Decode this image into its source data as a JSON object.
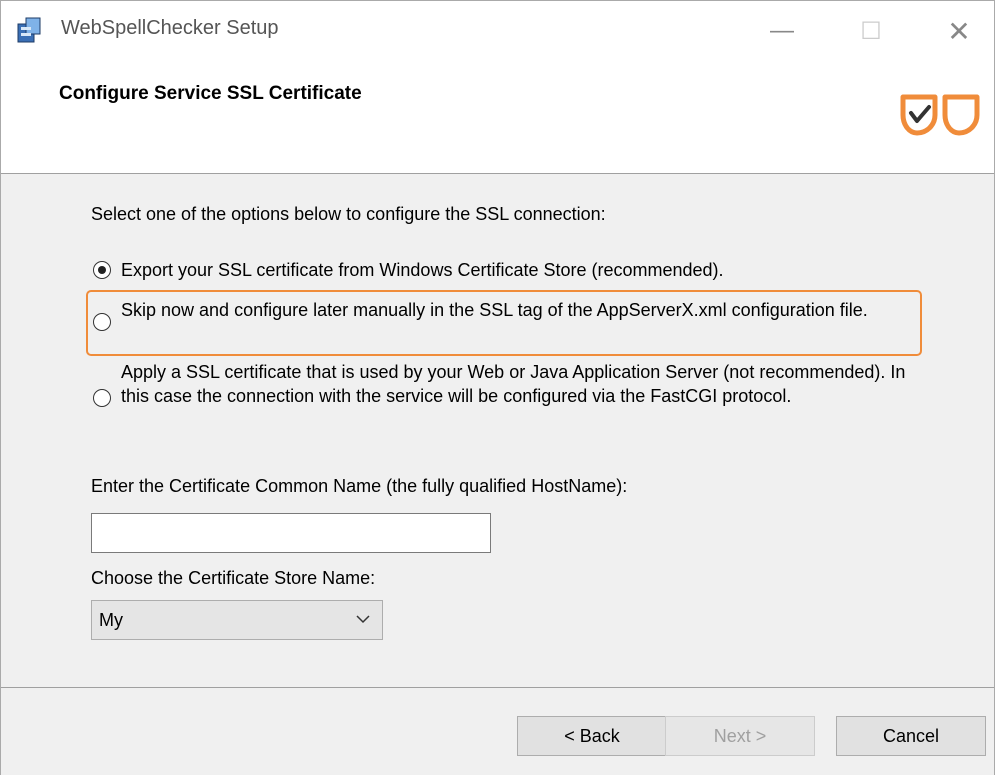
{
  "window": {
    "title": "WebSpellChecker Setup",
    "controls": {
      "minimize": "—",
      "maximize": "☐",
      "close": "✕"
    }
  },
  "header": {
    "title": "Configure Service SSL Certificate"
  },
  "content": {
    "intro": "Select one of the options below to configure the SSL connection:",
    "options": [
      {
        "label": "Export your SSL certificate from Windows Certificate Store (recommended).",
        "selected": true
      },
      {
        "label": "Skip now and configure later manually in the SSL tag of the AppServerX.xml configuration file.",
        "selected": false,
        "highlighted": true
      },
      {
        "label": "Apply a SSL certificate that is used by your Web or Java Application Server (not recommended). In this case the connection with the service will be configured via the FastCGI protocol.",
        "selected": false
      }
    ],
    "common_name_label": "Enter the Certificate Common Name (the fully qualified HostName):",
    "common_name_value": "",
    "store_label": "Choose the Certificate Store Name:",
    "store_selected": "My"
  },
  "footer": {
    "back": "< Back",
    "next": "Next >",
    "cancel": "Cancel"
  },
  "colors": {
    "highlight": "#f08c3a",
    "logo": "#f08c3a"
  },
  "icons": {
    "app": "installer-icon",
    "logo": "webspellchecker-logo"
  }
}
